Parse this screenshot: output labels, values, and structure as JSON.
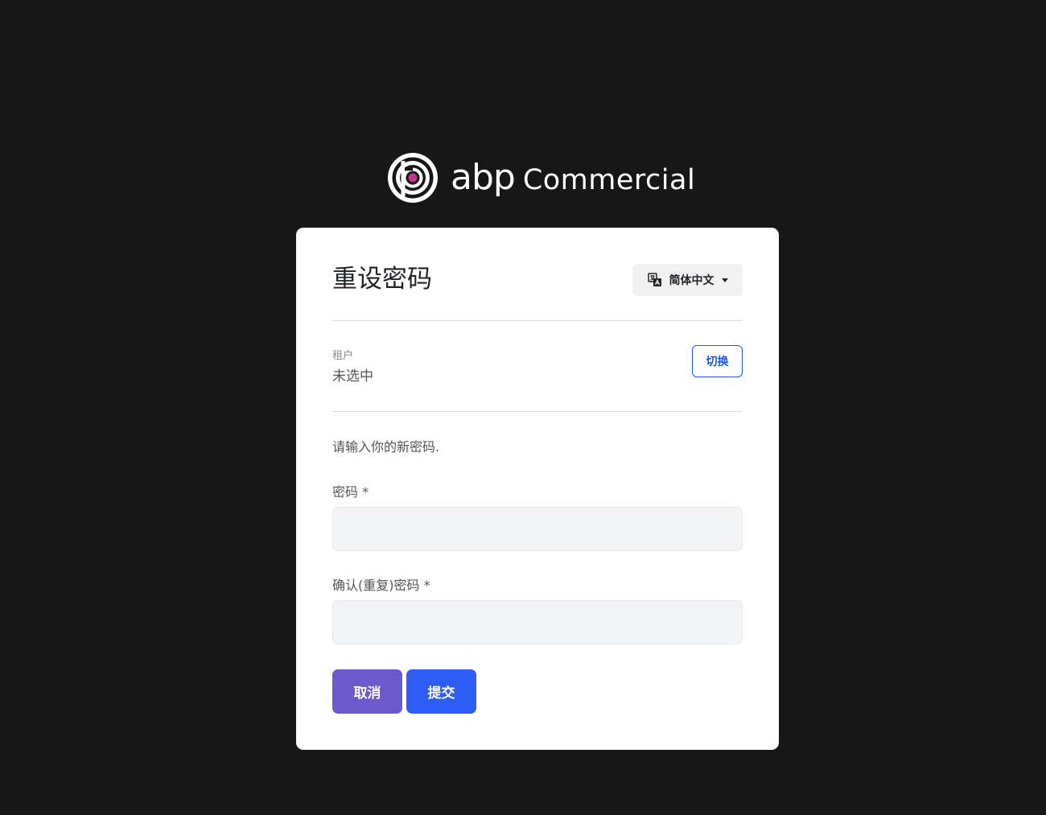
{
  "brand": {
    "abp": "abp",
    "commercial": "Commercial"
  },
  "page": {
    "title": "重设密码"
  },
  "language": {
    "selected": "简体中文",
    "icon": "translate-icon"
  },
  "tenant": {
    "label": "租户",
    "value": "未选中",
    "switch_label": "切换"
  },
  "form": {
    "intro": "请输入你的新密码.",
    "password_label": "密码 *",
    "password_value": "",
    "confirm_label": "确认(重复)密码 *",
    "confirm_value": "",
    "cancel_label": "取消",
    "submit_label": "提交"
  },
  "colors": {
    "background": "#171717",
    "card": "#ffffff",
    "primary": "#2e5cf6",
    "secondary": "#6c5acd",
    "logo_accent": "#c2378e"
  }
}
